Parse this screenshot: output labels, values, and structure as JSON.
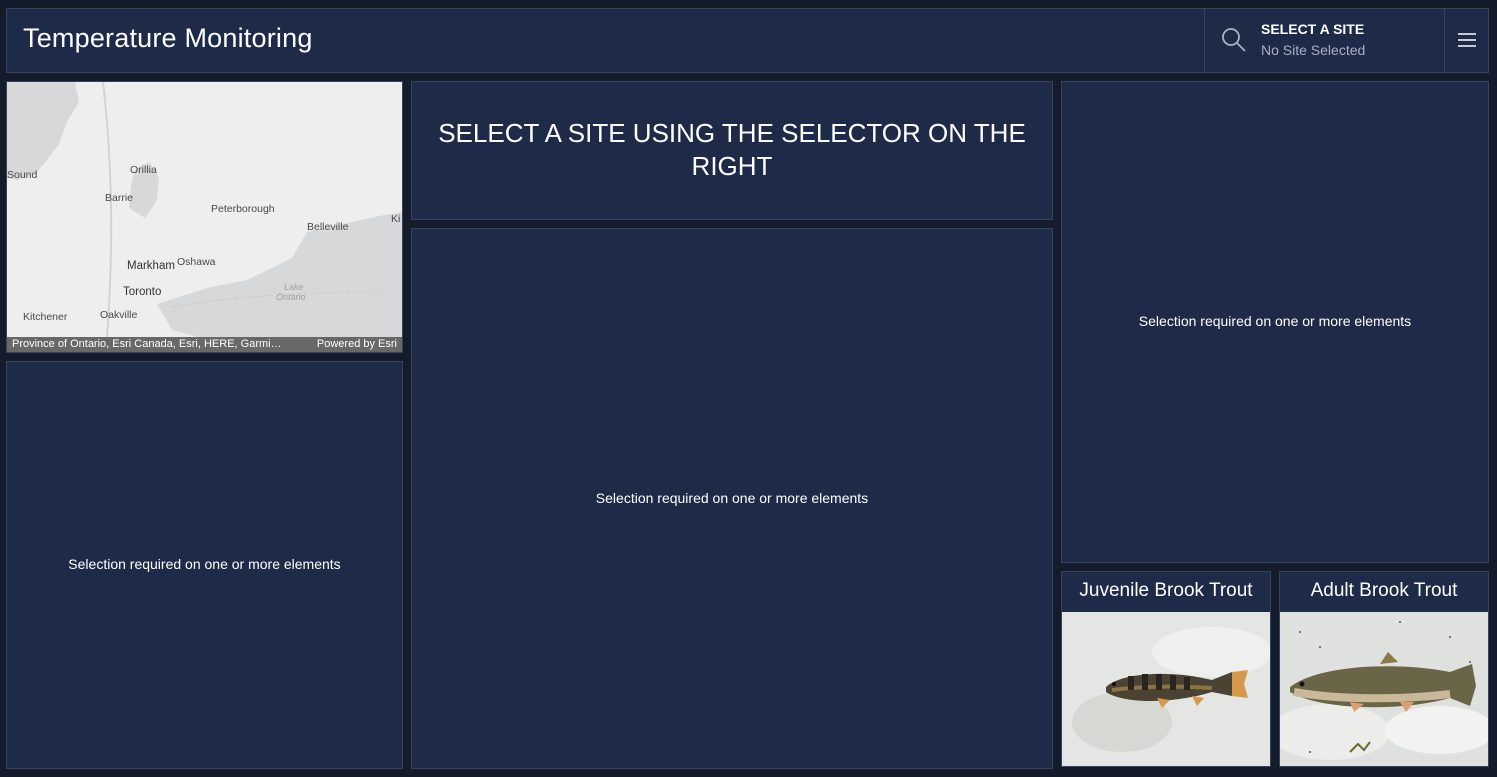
{
  "header": {
    "title": "Temperature Monitoring",
    "selector_label": "SELECT A SITE",
    "selector_value": "No Site Selected"
  },
  "map": {
    "places": [
      "Sound",
      "Orillia",
      "Barrie",
      "Peterborough",
      "Belleville",
      "Ki",
      "Markham",
      "Oshawa",
      "Toronto",
      "Lake",
      "Ontario",
      "Kitchener",
      "Oakville"
    ],
    "attribution_left": "Province of Ontario, Esri Canada, Esri, HERE, Garmi…",
    "attribution_right": "Powered by Esri"
  },
  "main": {
    "heading": "SELECT A SITE USING THE SELECTOR ON THE RIGHT",
    "center_message": "Selection required on one or more elements",
    "right_message": "Selection required on one or more elements",
    "left_message": "Selection required on one or more elements"
  },
  "fish": [
    {
      "title": "Juvenile Brook Trout"
    },
    {
      "title": "Adult Brook Trout"
    }
  ],
  "colors": {
    "background": "#141c2b",
    "panel": "#1e2b48",
    "border": "#36425e",
    "muted_text": "#a7b0c3"
  },
  "icons": [
    "search-icon",
    "menu-icon"
  ]
}
